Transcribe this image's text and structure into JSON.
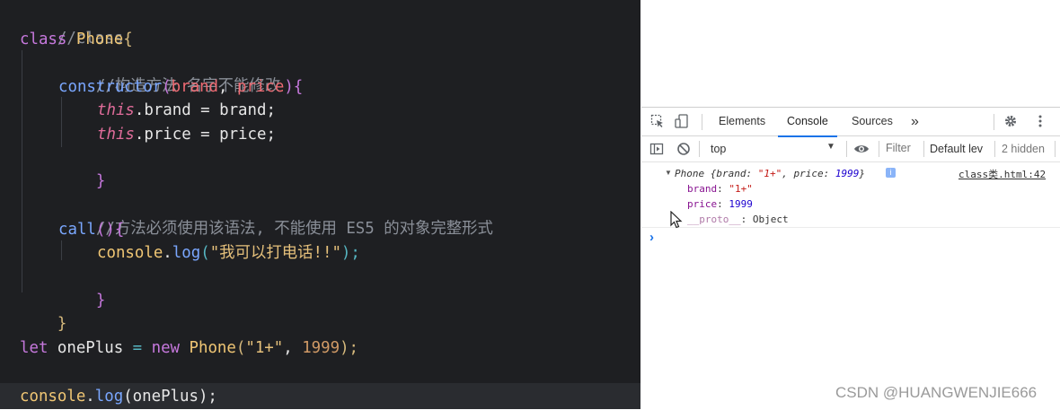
{
  "editor": {
    "line1": "//class",
    "line2_kw": "class",
    "line2_name": "Phone",
    "line2_brace": "{",
    "line3": "//构造方法 名字不能修改",
    "line4_fn": "constructor",
    "line4_open": "(",
    "line4_p1": "brand",
    "line4_sep": ", ",
    "line4_p2": "price",
    "line4_close": "){",
    "line5_this": "this",
    "line5_rest": ".brand = brand;",
    "line6_this": "this",
    "line6_rest": ".price = price;",
    "line7": "}",
    "line9": "//方法必须使用该语法, 不能使用 ES5 的对象完整形式",
    "line10_fn": "call",
    "line10_rest": "(){",
    "line11_obj": "console",
    "line11_dot": ".",
    "line11_fn": "log",
    "line11_open": "(",
    "line11_str": "\"我可以打电话!!\"",
    "line11_close": ");",
    "line12": "}",
    "line13": "}",
    "line15_kw": "let",
    "line15_var": " onePlus ",
    "line15_eq": "=",
    "line15_new": " new ",
    "line15_cls": "Phone",
    "line15_open": "(",
    "line15_str": "\"1+\"",
    "line15_sep": ", ",
    "line15_num": "1999",
    "line15_close": ");",
    "line17_obj": "console",
    "line17_dot": ".",
    "line17_fn": "log",
    "line17_arg": "(onePlus);"
  },
  "devtools": {
    "tabs": [
      "Elements",
      "Console",
      "Sources"
    ],
    "more_tabs": "»",
    "context": "top",
    "filter_placeholder": "Filter",
    "levels": "Default lev",
    "hidden_count": "2 hidden",
    "log": {
      "summary_prefix": "Phone {brand: ",
      "summary_brand": "\"1+\"",
      "summary_mid": ", price: ",
      "summary_price": "1999",
      "summary_suffix": "}",
      "info_badge": "i",
      "source_link": "class类.html:42",
      "prop_brand_key": "brand",
      "prop_brand_val": "\"1+\"",
      "prop_price_key": "price",
      "prop_price_val": "1999",
      "proto_key": "__proto__",
      "proto_val": ": Object"
    },
    "prompt": "›"
  },
  "watermark": "CSDN @HUANGWENJIE666",
  "colors": {
    "editor_bg": "#1e1f22",
    "accent": "#1a73e8",
    "keyword": "#c678dd",
    "class": "#f0c674",
    "function": "#7aa7ff",
    "param": "#ef6b73",
    "comment": "#8a8f98"
  }
}
